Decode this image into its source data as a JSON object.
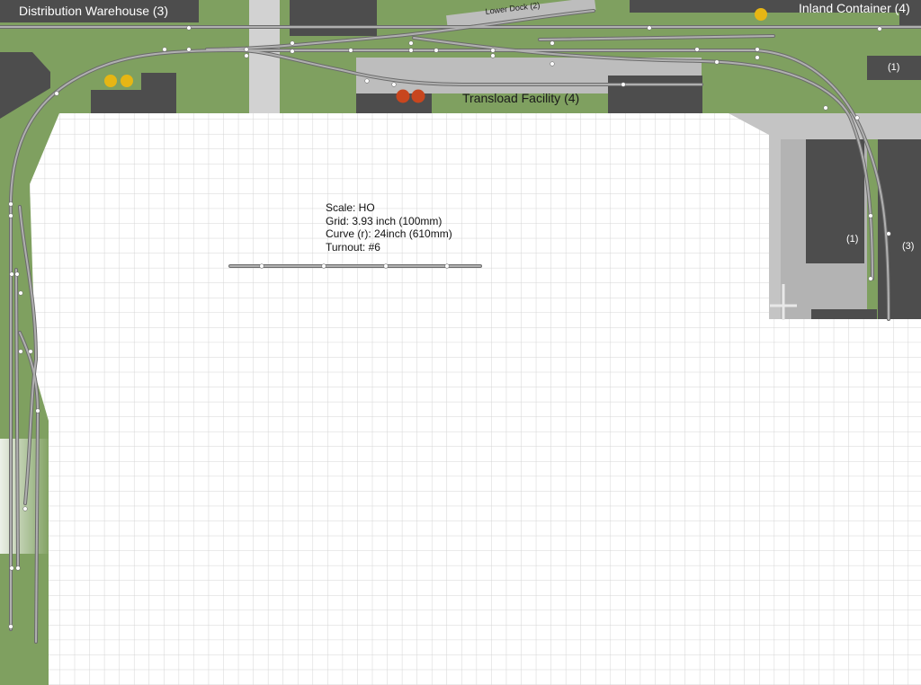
{
  "industries": {
    "distribution_warehouse": "Distribution Warehouse (3)",
    "inland_container": "Inland Container (4)",
    "lower_dock": "Lower Dock (2)",
    "transload_facility": "Transload Facility (4)",
    "spot_upper_right": "(1)",
    "spot_right_inner": "(1)",
    "spot_right_outer": "(3)"
  },
  "legend": {
    "scale": "Scale: HO",
    "grid": "Grid: 3.93 inch (100mm)",
    "curve": "Curve (r): 24inch (610mm)",
    "turnout": "Turnout: #6"
  },
  "colors": {
    "scenery_green": "#7fa060",
    "building_dark": "#4d4d4d",
    "pavement_gray": "#bdbdbd",
    "street_light": "#d2d2d2",
    "track_gray": "#8e8e8e",
    "grid_line": "#d4d4d4",
    "tank_yellow": "#e6b614",
    "tank_orange": "#c8461e"
  }
}
